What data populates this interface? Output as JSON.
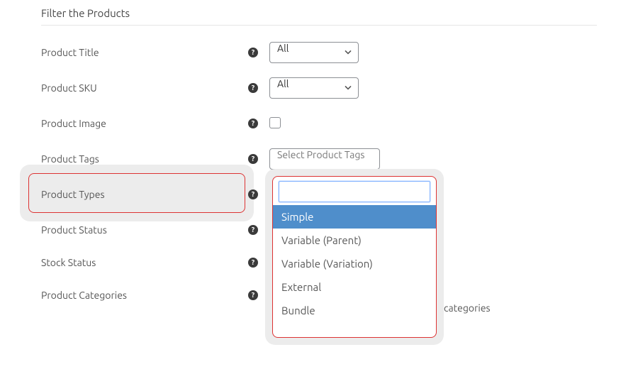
{
  "section": {
    "title": "Filter the Products"
  },
  "rows": {
    "product_title": {
      "label": "Product Title",
      "selected": "All"
    },
    "product_sku": {
      "label": "Product SKU",
      "selected": "All"
    },
    "product_image": {
      "label": "Product Image"
    },
    "product_tags": {
      "label": "Product Tags",
      "placeholder": "Select Product Tags"
    },
    "product_types": {
      "label": "Product Types"
    },
    "product_status": {
      "label": "Product Status"
    },
    "stock_status": {
      "label": "Stock Status"
    },
    "product_categories": {
      "label": "Product Categories"
    }
  },
  "dropdown": {
    "options": [
      "Simple",
      "Variable (Parent)",
      "Variable (Variation)",
      "External",
      "Bundle"
    ],
    "hover_index": 0
  },
  "peek_text": {
    "categories_tail": "categories"
  }
}
